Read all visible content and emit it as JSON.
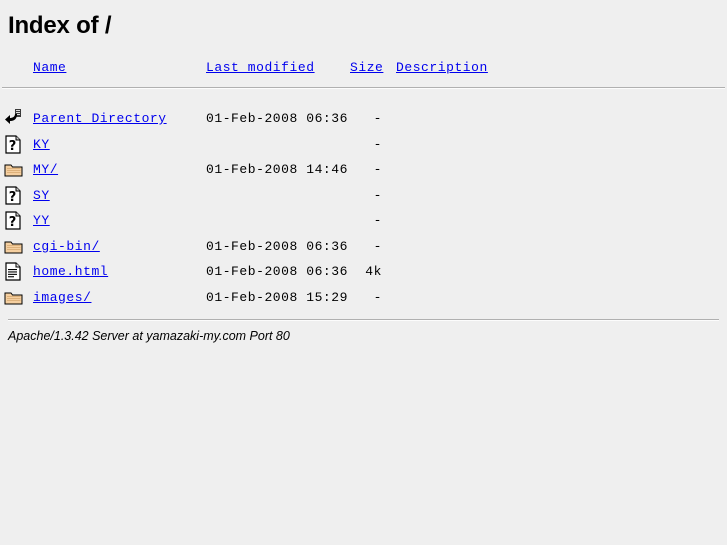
{
  "page": {
    "title": "Index of /"
  },
  "table": {
    "headers": [
      {
        "label": "Name",
        "icon": "sort-name-icon"
      },
      {
        "label": "Last modified",
        "icon": "sort-date-icon"
      },
      {
        "label": "Size",
        "icon": "sort-size-icon"
      },
      {
        "label": "Description",
        "icon": "sort-desc-icon"
      }
    ],
    "rows": [
      {
        "icon": "parent-directory-icon",
        "name": "Parent Directory",
        "date": "01-Feb-2008 06:36",
        "size": "-",
        "desc": ""
      },
      {
        "icon": "unknown-file-icon",
        "name": "KY",
        "date": "",
        "size": "-",
        "desc": ""
      },
      {
        "icon": "folder-icon",
        "name": "MY/",
        "date": "01-Feb-2008 14:46",
        "size": "-",
        "desc": ""
      },
      {
        "icon": "unknown-file-icon",
        "name": "SY",
        "date": "",
        "size": "-",
        "desc": ""
      },
      {
        "icon": "unknown-file-icon",
        "name": "YY",
        "date": "",
        "size": "-",
        "desc": ""
      },
      {
        "icon": "folder-icon",
        "name": "cgi-bin/",
        "date": "01-Feb-2008 06:36",
        "size": "-",
        "desc": ""
      },
      {
        "icon": "text-html-icon",
        "name": "home.html",
        "date": "01-Feb-2008 06:36",
        "size": "4k",
        "desc": ""
      },
      {
        "icon": "folder-icon",
        "name": "images/",
        "date": "01-Feb-2008 15:29",
        "size": "-",
        "desc": ""
      }
    ]
  },
  "footer": {
    "text": "Apache/1.3.42 Server at yamazaki-my.com Port 80"
  },
  "colors": {
    "background": "#efefef",
    "link": "#0000ee",
    "text": "#000000",
    "rule": "#b0b0b0",
    "folder_fill": "#f5cfa0",
    "folder_edge": "#000000"
  }
}
